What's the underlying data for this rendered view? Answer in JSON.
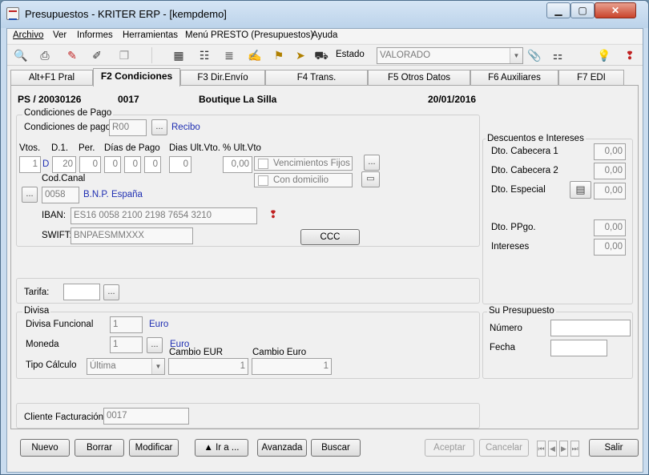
{
  "window": {
    "title": "Presupuestos - KRITER ERP - [kempdemo]"
  },
  "menu": [
    "Archivo",
    "Ver",
    "Informes",
    "Herramientas",
    "Menú PRESTO (Presupuestos)",
    "Ayuda"
  ],
  "toolbar": {
    "estado_label": "Estado",
    "estado_value": "VALORADO"
  },
  "tabs": [
    "Alt+F1 Pral",
    "F2 Condiciones",
    "F3 Dir.Envío",
    "F4 Trans.",
    "F5 Otros Datos",
    "F6 Auxiliares",
    "F7 EDI"
  ],
  "header": {
    "doc": "PS / 20030126",
    "code": "0017",
    "client": "Boutique La Silla",
    "date": "20/01/2016"
  },
  "cond": {
    "title": "Condiciones de Pago",
    "label": "Condiciones de pago",
    "code": "R00",
    "desc": "Recibo",
    "vtos_lbl": "Vtos.",
    "d1_lbl": "D.1.",
    "per_lbl": "Per.",
    "dias_pago_lbl": "Días de Pago",
    "dias_ult_lbl": "Dias Ult.Vto.",
    "pct_lbl": "% Ult.Vto",
    "vtos": "1",
    "d_marker": "D",
    "d1": "20",
    "per": "0",
    "dp1": "0",
    "dp2": "0",
    "dp3": "0",
    "dias_ult": "0",
    "pct": "0,00",
    "venc_fijos": "Vencimientos Fijos",
    "con_domicilio": "Con domicilio",
    "cod_canal_lbl": "Cod.Canal",
    "canal_code": "0058",
    "canal_desc": "B.N.P. España",
    "iban_lbl": "IBAN:",
    "iban": "ES16 0058 2100 2198 7654 3210",
    "swift_lbl": "SWIFT:",
    "swift": "BNPAESMMXXX",
    "ccc": "CCC"
  },
  "tarifa": {
    "label": "Tarifa:"
  },
  "divisa": {
    "title": "Divisa",
    "funcional_lbl": "Divisa Funcional",
    "funcional": "1",
    "funcional_desc": "Euro",
    "moneda_lbl": "Moneda",
    "moneda": "1",
    "moneda_desc": "Euro",
    "cambio_eur_lbl": "Cambio EUR",
    "cambio_moneda_lbl": "Cambio Euro",
    "tipo_lbl": "Tipo Cálculo",
    "tipo": "Última",
    "cambio_eur": "1",
    "cambio_moneda": "1"
  },
  "cliente": {
    "label": "Cliente Facturación",
    "value": "0017"
  },
  "descuentos": {
    "title": "Descuentos e Intereses",
    "cab1_lbl": "Dto. Cabecera 1",
    "cab1": "0,00",
    "cab2_lbl": "Dto. Cabecera 2",
    "cab2": "0,00",
    "esp_lbl": "Dto. Especial",
    "esp": "0,00",
    "ppgo_lbl": "Dto. PPgo.",
    "ppgo": "0,00",
    "int_lbl": "Intereses",
    "int": "0,00"
  },
  "supres": {
    "title": "Su Presupuesto",
    "numero_lbl": "Número",
    "fecha_lbl": "Fecha"
  },
  "buttons": {
    "nuevo": "Nuevo",
    "borrar": "Borrar",
    "modificar": "Modificar",
    "ira": "▲ Ir a ...",
    "avanzada": "Avanzada",
    "buscar": "Buscar",
    "aceptar": "Aceptar",
    "cancelar": "Cancelar",
    "salir": "Salir"
  }
}
